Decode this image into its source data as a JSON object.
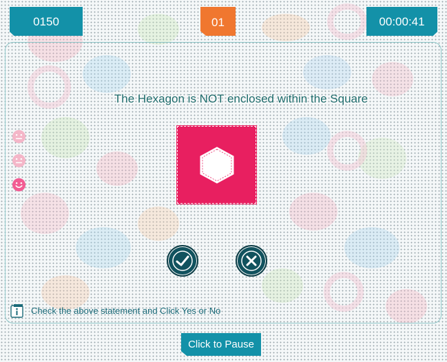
{
  "header": {
    "score": "0150",
    "round": "01",
    "timer": "00:00:41"
  },
  "question": {
    "statement": "The Hexagon is NOT enclosed within the Square",
    "shape_colors": {
      "square": "#e81f60",
      "hexagon": "#ffffff"
    }
  },
  "answer_buttons": {
    "yes_icon": "check-icon",
    "no_icon": "cross-icon"
  },
  "feedback_faces": [
    {
      "icon": "neutral-face-icon",
      "color": "#f4b6c8"
    },
    {
      "icon": "neutral-face-icon",
      "color": "#f4b6c8"
    },
    {
      "icon": "smile-face-icon",
      "color": "#f25c93"
    }
  ],
  "footer": {
    "instruction": "Check the above statement and Click Yes or No",
    "pause_label": "Click to Pause"
  },
  "colors": {
    "accent": "#1391a8",
    "round_badge": "#f0772f",
    "button_dark": "#11525e"
  }
}
